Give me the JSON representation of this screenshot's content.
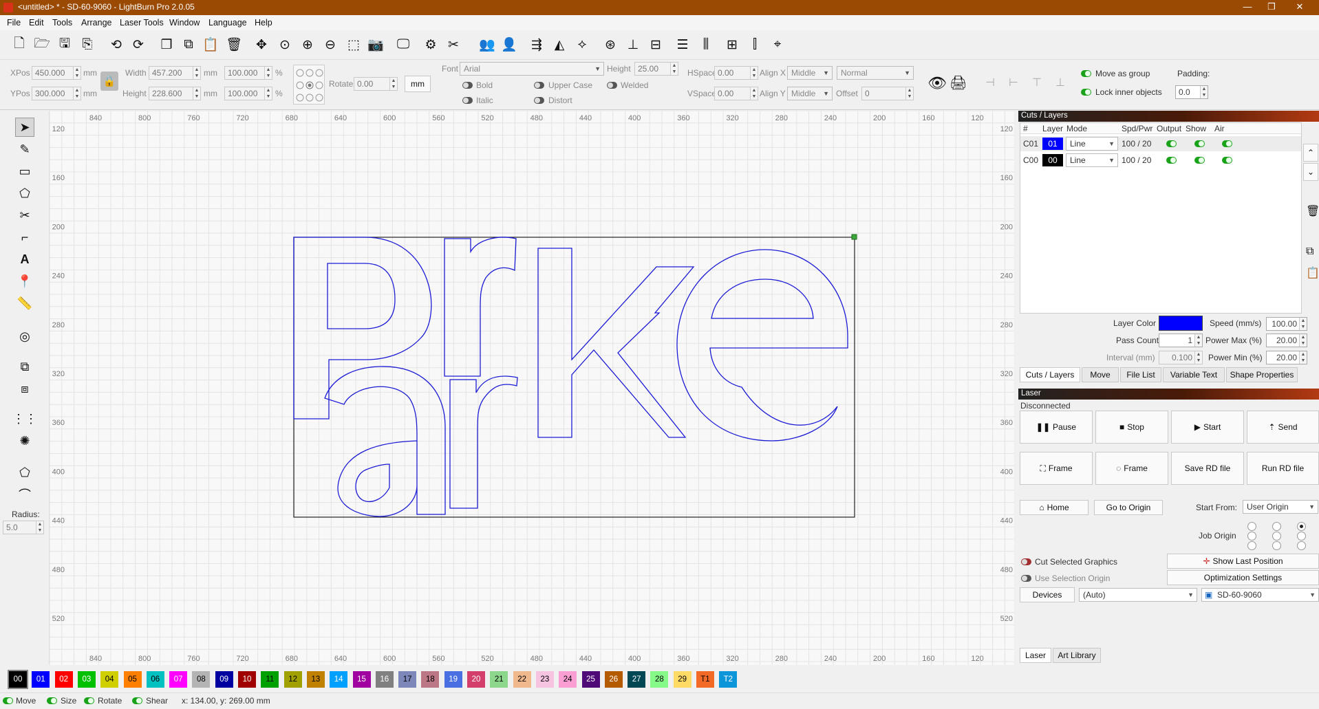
{
  "titlebar": {
    "title": "<untitled> * - SD-60-9060 - LightBurn Pro 2.0.05",
    "minimize": "—",
    "maximize": "❐",
    "close": "✕"
  },
  "menu": [
    "File",
    "Edit",
    "Tools",
    "Arrange",
    "Laser Tools",
    "Window",
    "Language",
    "Help"
  ],
  "toolbar_icons": [
    "new-file-icon",
    "open-file-icon",
    "save-icon",
    "save-as-icon",
    "undo-icon",
    "redo-icon",
    "copy-icon",
    "duplicate-icon",
    "paste-icon",
    "delete-icon",
    "move-icon",
    "zoom-fit-icon",
    "zoom-in-icon",
    "zoom-out-icon",
    "zoom-selection-icon",
    "camera-icon",
    "monitor-icon",
    "settings-icon",
    "tools-icon",
    "group-icon",
    "ungroup-icon",
    "mirror-h-icon",
    "mirror-v-icon",
    "rotate-icon",
    "center-icon",
    "align-left-icon",
    "align-center-icon",
    "align-middle-icon",
    "align-right-icon",
    "distribute-h-icon",
    "distribute-v-icon",
    "crosshair-icon"
  ],
  "props": {
    "xpos_label": "XPos",
    "xpos": "450.000",
    "ypos_label": "YPos",
    "ypos": "300.000",
    "unit": "mm",
    "width_label": "Width",
    "width": "457.200",
    "height_label": "Height",
    "height": "228.600",
    "wpct": "100.000",
    "hpct": "100.000",
    "pct": "%",
    "rotate_label": "Rotate",
    "rotate": "0.00",
    "mm_button": "mm",
    "font_label": "Font",
    "font": "Arial",
    "fheight_label": "Height",
    "fheight": "25.00",
    "bold": "Bold",
    "italic": "Italic",
    "upper": "Upper Case",
    "distort": "Distort",
    "welded": "Welded",
    "hspace_label": "HSpace",
    "hspace": "0.00",
    "vspace_label": "VSpace",
    "vspace": "0.00",
    "alignx_label": "Align X",
    "alignx": "Middle",
    "aligny_label": "Align Y",
    "aligny": "Middle",
    "mode": "Normal",
    "offset_label": "Offset",
    "offset": "0",
    "move_group": "Move as group",
    "lock_inner": "Lock inner objects",
    "padding_label": "Padding:",
    "padding": "0.0"
  },
  "left_tools": {
    "radius_label": "Radius:",
    "radius": "5.0"
  },
  "canvas": {
    "x_ticks": [
      "840",
      "800",
      "760",
      "720",
      "680",
      "640",
      "600",
      "560",
      "520",
      "480",
      "440",
      "400",
      "360",
      "320",
      "280",
      "240",
      "200",
      "160",
      "120"
    ],
    "y_ticks": [
      "120",
      "160",
      "200",
      "240",
      "280",
      "320",
      "360",
      "400",
      "440",
      "480",
      "520"
    ],
    "shape_color": "#1b1bd6",
    "box_color": "#222222"
  },
  "cuts": {
    "title": "Cuts / Layers",
    "headers": [
      "#",
      "Layer",
      "Mode",
      "Spd/Pwr",
      "Output",
      "Show",
      "Air"
    ],
    "rows": [
      {
        "id": "C01",
        "layer": "01",
        "color": "#0000ff",
        "mode": "Line",
        "spdpwr": "100 / 20"
      },
      {
        "id": "C00",
        "layer": "00",
        "color": "#000000",
        "mode": "Line",
        "spdpwr": "100 / 20"
      }
    ],
    "layer_color_label": "Layer Color",
    "layer_color": "#0000ff",
    "speed_label": "Speed (mm/s)",
    "speed": "100.00",
    "pass_label": "Pass Count",
    "pass": "1",
    "pmax_label": "Power Max (%)",
    "pmax": "20.00",
    "interval_label": "Interval (mm)",
    "interval": "0.100",
    "pmin_label": "Power Min (%)",
    "pmin": "20.00",
    "tabs": [
      "Cuts / Layers",
      "Move",
      "File List",
      "Variable Text",
      "Shape Properties"
    ]
  },
  "laser": {
    "title": "Laser",
    "status": "Disconnected",
    "pause": "Pause",
    "stop": "Stop",
    "start": "Start",
    "send": "Send",
    "frame1": "Frame",
    "frame2": "Frame",
    "save_rd": "Save RD file",
    "run_rd": "Run RD file",
    "home": "Home",
    "goto_origin": "Go to Origin",
    "start_from_label": "Start From:",
    "start_from": "User Origin",
    "job_origin_label": "Job Origin",
    "cut_selected": "Cut Selected Graphics",
    "use_sel_origin": "Use Selection Origin",
    "show_last": "Show Last Position",
    "opt_settings": "Optimization Settings",
    "devices": "Devices",
    "auto": "(Auto)",
    "device": "SD-60-9060",
    "tabs": [
      "Laser",
      "Art Library"
    ]
  },
  "palette": [
    {
      "n": "00",
      "c": "#000000",
      "f": "#ffffff"
    },
    {
      "n": "01",
      "c": "#0000ff",
      "f": "#ffffff"
    },
    {
      "n": "02",
      "c": "#ff0000",
      "f": "#ffffff"
    },
    {
      "n": "03",
      "c": "#00c000",
      "f": "#ffffff"
    },
    {
      "n": "04",
      "c": "#d0d000",
      "f": "#000000"
    },
    {
      "n": "05",
      "c": "#ff8000",
      "f": "#000000"
    },
    {
      "n": "06",
      "c": "#00c0c0",
      "f": "#000000"
    },
    {
      "n": "07",
      "c": "#ff00ff",
      "f": "#ffffff"
    },
    {
      "n": "08",
      "c": "#b4b4b4",
      "f": "#000000"
    },
    {
      "n": "09",
      "c": "#0000a0",
      "f": "#ffffff"
    },
    {
      "n": "10",
      "c": "#a00000",
      "f": "#ffffff"
    },
    {
      "n": "11",
      "c": "#00a000",
      "f": "#000000"
    },
    {
      "n": "12",
      "c": "#a0a000",
      "f": "#000000"
    },
    {
      "n": "13",
      "c": "#c08000",
      "f": "#000000"
    },
    {
      "n": "14",
      "c": "#00a0ff",
      "f": "#ffffff"
    },
    {
      "n": "15",
      "c": "#a000a0",
      "f": "#ffffff"
    },
    {
      "n": "16",
      "c": "#808080",
      "f": "#ffffff"
    },
    {
      "n": "17",
      "c": "#7d87b9",
      "f": "#000000"
    },
    {
      "n": "18",
      "c": "#bb7784",
      "f": "#000000"
    },
    {
      "n": "19",
      "c": "#4a6fe3",
      "f": "#ffffff"
    },
    {
      "n": "20",
      "c": "#d33f6a",
      "f": "#ffffff"
    },
    {
      "n": "21",
      "c": "#8cd78c",
      "f": "#000000"
    },
    {
      "n": "22",
      "c": "#f0b98d",
      "f": "#000000"
    },
    {
      "n": "23",
      "c": "#f6c4e1",
      "f": "#000000"
    },
    {
      "n": "24",
      "c": "#fa9ed4",
      "f": "#000000"
    },
    {
      "n": "25",
      "c": "#500a78",
      "f": "#ffffff"
    },
    {
      "n": "26",
      "c": "#b45a00",
      "f": "#ffffff"
    },
    {
      "n": "27",
      "c": "#004754",
      "f": "#ffffff"
    },
    {
      "n": "28",
      "c": "#86fa88",
      "f": "#000000"
    },
    {
      "n": "29",
      "c": "#ffdb66",
      "f": "#000000"
    },
    {
      "n": "T1",
      "c": "#f36926",
      "f": "#000000"
    },
    {
      "n": "T2",
      "c": "#0c96d9",
      "f": "#ffffff"
    }
  ],
  "status": {
    "move": "Move",
    "size": "Size",
    "rotate": "Rotate",
    "shear": "Shear",
    "coords": "x: 134.00, y: 269.00 mm"
  }
}
